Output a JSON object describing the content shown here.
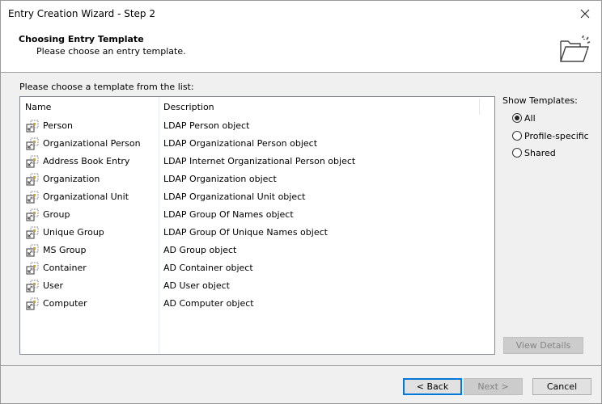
{
  "window": {
    "title": "Entry Creation Wizard - Step 2",
    "close_icon": "close-icon"
  },
  "header": {
    "title": "Choosing Entry Template",
    "subtitle": "Please choose an entry template.",
    "icon": "new-folder-icon"
  },
  "list": {
    "label": "Please choose a template from the list:",
    "columns": [
      "Name",
      "Description"
    ],
    "rows": [
      {
        "name": "Person",
        "description": "LDAP Person object"
      },
      {
        "name": "Organizational Person",
        "description": "LDAP Organizational Person object"
      },
      {
        "name": "Address Book Entry",
        "description": "LDAP Internet Organizational Person object"
      },
      {
        "name": "Organization",
        "description": "LDAP Organization object"
      },
      {
        "name": "Organizational Unit",
        "description": "LDAP Organizational Unit object"
      },
      {
        "name": "Group",
        "description": "LDAP Group Of Names object"
      },
      {
        "name": "Unique Group",
        "description": "LDAP Group Of Unique Names object"
      },
      {
        "name": "MS Group",
        "description": "AD Group object"
      },
      {
        "name": "Container",
        "description": "AD Container object"
      },
      {
        "name": "User",
        "description": "AD User object"
      },
      {
        "name": "Computer",
        "description": "AD Computer object"
      }
    ]
  },
  "show_templates": {
    "label": "Show Templates:",
    "options": [
      "All",
      "Profile-specific",
      "Shared"
    ],
    "selected": "All"
  },
  "buttons": {
    "view_details": "View Details",
    "back": "< Back",
    "next": "Next >",
    "cancel": "Cancel"
  },
  "colors": {
    "focus": "#0078d7",
    "icon_accent": "#d9a21b"
  }
}
